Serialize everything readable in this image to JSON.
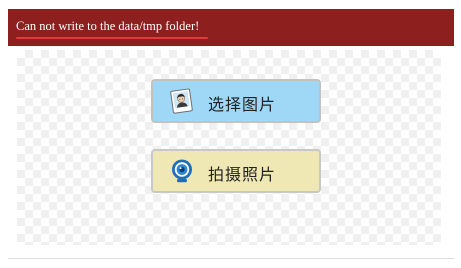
{
  "error": {
    "message": "Can not write to the data/tmp folder!"
  },
  "buttons": {
    "select_photo": {
      "label": "选择图片",
      "icon": "photo-portrait-icon",
      "color": "#9fd8f7"
    },
    "take_photo": {
      "label": "拍摄照片",
      "icon": "webcam-icon",
      "color": "#efe8b4"
    }
  },
  "colors": {
    "error_bar": "#8e1f1f",
    "error_underline": "#e03a3a"
  }
}
